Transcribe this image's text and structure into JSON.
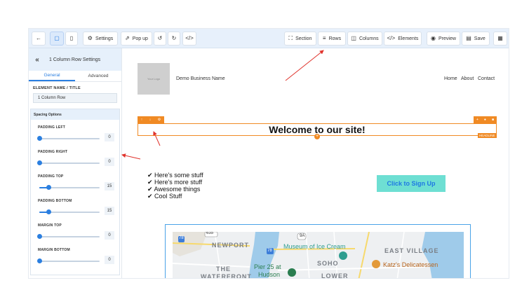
{
  "toolbar": {
    "back_icon": "arrow-left-icon",
    "settings_label": "Settings",
    "popup_label": "Pop up",
    "section_label": "Section",
    "rows_label": "Rows",
    "columns_label": "Columns",
    "elements_label": "Elements",
    "preview_label": "Preview",
    "save_label": "Save"
  },
  "sidebar": {
    "title": "1 Column Row Settings",
    "tabs": [
      "General",
      "Advanced"
    ],
    "element_name_label": "ELEMENT NAME / TITLE",
    "element_name_value": "1 Column Row",
    "spacing_title": "Spacing Options",
    "spacing": [
      {
        "label": "PADDING LEFT",
        "value": "0",
        "level": 0
      },
      {
        "label": "PADDING RIGHT",
        "value": "0",
        "level": 0
      },
      {
        "label": "PADDING TOP",
        "value": "15",
        "level": 0.15
      },
      {
        "label": "PADDING BOTTOM",
        "value": "15",
        "level": 0.15
      },
      {
        "label": "MARGIN TOP",
        "value": "0",
        "level": 0
      },
      {
        "label": "MARGIN BOTTOM",
        "value": "0",
        "level": 0
      }
    ]
  },
  "canvas": {
    "logo_text": "Your Logo",
    "business_name": "Demo Business Name",
    "nav": [
      "Home",
      "About",
      "Contact"
    ],
    "headline": "Welcome to our site!",
    "headline_tag": "HEADLINE",
    "bullets": [
      "✔ Here's some stuff",
      "✔ Here's more stuff",
      "✔ Awesome things",
      "✔ Cool Stuff"
    ],
    "cta_label": "Click to Sign Up",
    "map": {
      "labels": [
        "NEWPORT",
        "THE",
        "WATERFRONT",
        "EAST VILLAGE",
        "SOHO",
        "LOWER"
      ],
      "pois": [
        "Museum of Ice Cream",
        "Pier 25 at",
        "Hudson",
        "Katz's Delicatessen"
      ],
      "road_shields": [
        "635",
        "78",
        "78",
        "9A"
      ]
    }
  },
  "colors": {
    "accent": "#2b7fe0",
    "orange": "#f08a24",
    "cta_bg": "#6edfd3"
  }
}
